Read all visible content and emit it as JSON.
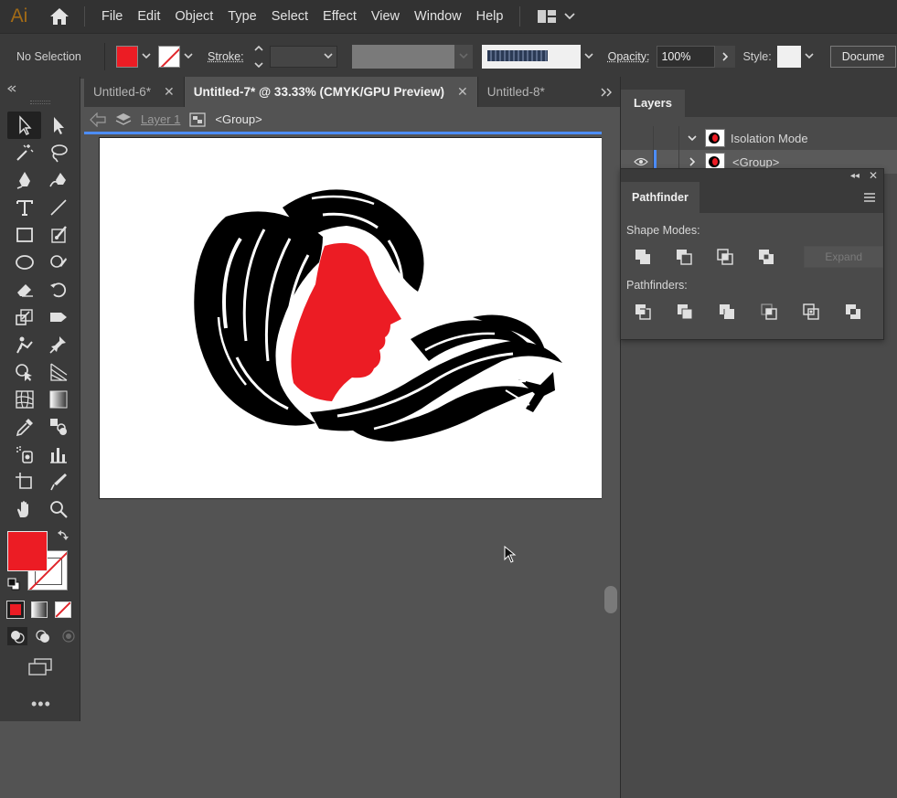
{
  "app": {
    "logo_text": "Ai"
  },
  "menu": {
    "items": [
      "File",
      "Edit",
      "Object",
      "Type",
      "Select",
      "Effect",
      "View",
      "Window",
      "Help"
    ]
  },
  "control_bar": {
    "selection_label": "No Selection",
    "fill_color": "#ec1c24",
    "stroke_label": "Stroke:",
    "opacity_label": "Opacity:",
    "opacity_value": "100%",
    "style_label": "Style:",
    "document_button": "Docume"
  },
  "tabs": [
    {
      "label": "Untitled-6*",
      "active": false
    },
    {
      "label": "Untitled-7* @ 33.33% (CMYK/GPU Preview)",
      "active": true
    },
    {
      "label": "Untitled-8*",
      "active": false
    }
  ],
  "breadcrumb": {
    "layer": "Layer 1",
    "group": "<Group>"
  },
  "layers_panel": {
    "tab": "Layers",
    "rows": [
      {
        "label": "Isolation Mode"
      },
      {
        "label": "<Group>"
      }
    ]
  },
  "pathfinder_panel": {
    "tab": "Pathfinder",
    "shape_modes_label": "Shape Modes:",
    "expand_label": "Expand",
    "pathfinders_label": "Pathfinders:"
  },
  "colors": {
    "accent_blue": "#4c8dff",
    "fill_red": "#ec1c24",
    "art_black": "#000000"
  }
}
